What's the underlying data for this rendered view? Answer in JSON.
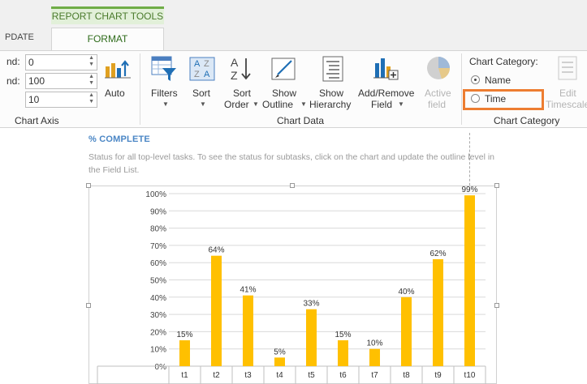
{
  "tabs": {
    "context_header": "REPORT CHART TOOLS",
    "update_label": "PDATE",
    "format_label": "FORMAT"
  },
  "chart_axis": {
    "field1_label": "nd:",
    "field1_value": "0",
    "field2_label": "nd:",
    "field2_value": "100",
    "field3_value": "10",
    "auto_label": "Auto",
    "group_label": "Chart Axis"
  },
  "chart_data_group": {
    "filters_label": "Filters",
    "sort_label": "Sort",
    "sort_order_line1": "Sort",
    "sort_order_line2": "Order",
    "show_outline_line1": "Show",
    "show_outline_line2": "Outline",
    "show_hierarchy_line1": "Show",
    "show_hierarchy_line2": "Hierarchy",
    "add_remove_line1": "Add/Remove",
    "add_remove_line2": "Field",
    "active_field_line1": "Active",
    "active_field_line2": "field",
    "group_label": "Chart Data"
  },
  "chart_category_group": {
    "heading": "Chart Category:",
    "option_name": "Name",
    "option_time": "Time",
    "selected": "Name",
    "edit_timescale_line1": "Edit",
    "edit_timescale_line2": "Timescale",
    "group_label": "Chart Category"
  },
  "report": {
    "title": "% COMPLETE",
    "description": "Status for all top-level tasks. To see the status for subtasks, click on the chart and update the outline level in the Field List."
  },
  "colors": {
    "bar": "#ffc000",
    "highlight": "#ed7d31",
    "context_tab": "#70ad47",
    "title": "#4a86c5"
  },
  "chart_data": {
    "type": "bar",
    "categories": [
      "t1",
      "t2",
      "t3",
      "t4",
      "t5",
      "t6",
      "t7",
      "t8",
      "t9",
      "t10"
    ],
    "values": [
      15,
      64,
      41,
      5,
      33,
      15,
      10,
      40,
      62,
      99
    ],
    "data_labels": [
      "15%",
      "64%",
      "41%",
      "5%",
      "33%",
      "15%",
      "10%",
      "40%",
      "62%",
      "99%"
    ],
    "y_ticks": [
      "0%",
      "10%",
      "20%",
      "30%",
      "40%",
      "50%",
      "60%",
      "70%",
      "80%",
      "90%",
      "100%"
    ],
    "ylim": [
      0,
      100
    ],
    "grid": true,
    "title": "",
    "xlabel": "",
    "ylabel": ""
  }
}
